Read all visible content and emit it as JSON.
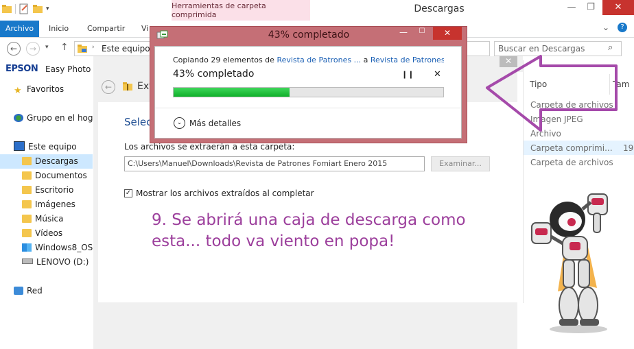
{
  "window": {
    "title": "Descargas",
    "context_tab": "Herramientas de carpeta comprimida"
  },
  "ribbon": {
    "tabs": [
      "Archivo",
      "Inicio",
      "Compartir",
      "Vi"
    ]
  },
  "address": {
    "path": "Este equipo",
    "search_placeholder": "Buscar en Descargas"
  },
  "sidebar": {
    "app_brand": "EPSON",
    "app_name": "Easy Photo P",
    "items": [
      {
        "label": "Favoritos"
      },
      {
        "label": "Grupo en el hogar"
      },
      {
        "label": "Este equipo"
      },
      {
        "label": "Descargas"
      },
      {
        "label": "Documentos"
      },
      {
        "label": "Escritorio"
      },
      {
        "label": "Imágenes"
      },
      {
        "label": "Música"
      },
      {
        "label": "Vídeos"
      },
      {
        "label": "Windows8_OS ("
      },
      {
        "label": "LENOVO (D:)"
      },
      {
        "label": "Red"
      }
    ]
  },
  "wizard": {
    "header_partial": "Ext",
    "heading_partial": "Selec",
    "dest_label": "Los archivos se extraerán a esta carpeta:",
    "dest_path": "C:\\Users\\Manuel\\Downloads\\Revista de Patrones Fomiart Enero 2015",
    "browse_label": "Examinar...",
    "show_files_label": "Mostrar los archivos extraídos al completar",
    "show_files_checked": true
  },
  "details": {
    "column_type": "Tipo",
    "column_size": "Tam",
    "rows": [
      {
        "type": "Carpeta de archivos",
        "size": ""
      },
      {
        "type": "Imagen JPEG",
        "size": ""
      },
      {
        "type": "Archivo",
        "size": ""
      },
      {
        "type": "Carpeta comprimi...",
        "size": "19"
      },
      {
        "type": "Carpeta de archivos",
        "size": ""
      }
    ]
  },
  "progress_dialog": {
    "title": "43% completado",
    "copy_prefix": "Copiando 29 elementos de",
    "source": "Revista de Patrones ...",
    "to_word": "a",
    "destination": "Revista de Patrones F...",
    "percent_text": "43% completado",
    "percent": 43,
    "more_details": "Más detalles"
  },
  "annotation": {
    "text": "9. Se abrirá una caja de descarga como esta... todo va viento en popa!",
    "color": "#9c3f9c"
  },
  "colors": {
    "accent": "#1979ca",
    "dialog_frame": "#c56f76",
    "progress": "#15b82f",
    "arrow": "#a54aaa"
  }
}
